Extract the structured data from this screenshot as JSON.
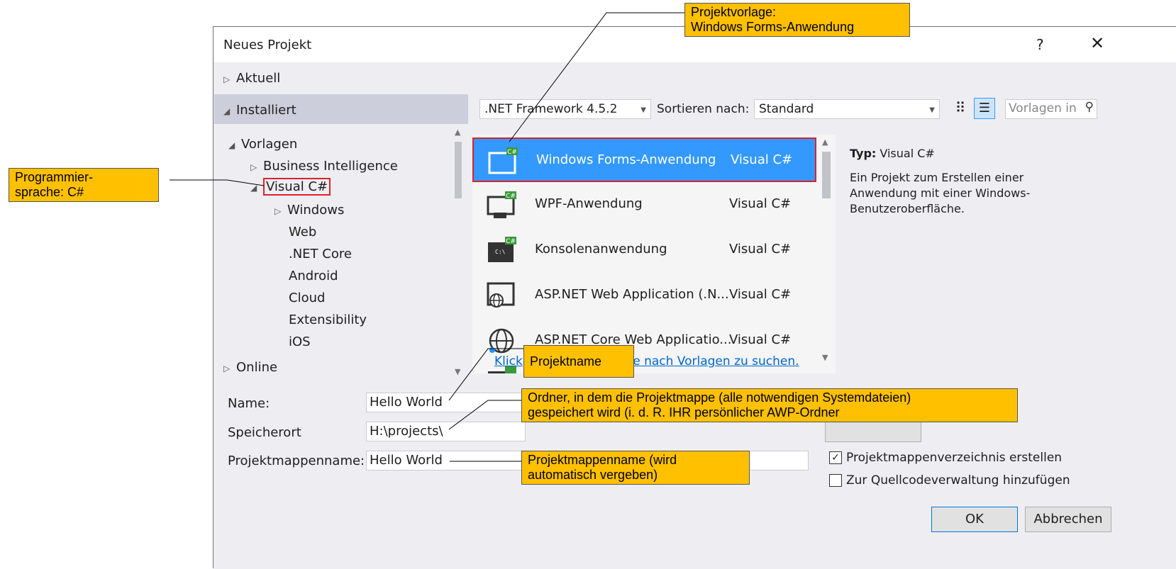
{
  "dialog": {
    "title": "Neues Projekt",
    "help": "?",
    "close": "✕"
  },
  "tree": {
    "aktuell": "Aktuell",
    "installiert": "Installiert",
    "vorlagen": "Vorlagen",
    "business_intelligence": "Business Intelligence",
    "visual_csharp": "Visual C#",
    "items": [
      "Windows",
      "Web",
      ".NET Core",
      "Android",
      "Cloud",
      "Extensibility",
      "iOS"
    ],
    "online": "Online"
  },
  "toolbar": {
    "framework": ".NET Framework 4.5.2",
    "sort_label": "Sortieren nach:",
    "sort_value": "Standard",
    "search_placeholder": "Vorlagen in"
  },
  "templates": [
    {
      "name": "Windows Forms-Anwendung",
      "lang": "Visual C#",
      "selected": true
    },
    {
      "name": "WPF-Anwendung",
      "lang": "Visual C#",
      "selected": false
    },
    {
      "name": "Konsolenanwendung",
      "lang": "Visual C#",
      "selected": false
    },
    {
      "name": "ASP.NET Web Application (.N...",
      "lang": "Visual C#",
      "selected": false
    },
    {
      "name": "ASP.NET Core Web Applicatio...",
      "lang": "Visual C#",
      "selected": false
    }
  ],
  "online_link": "Klicken Sie hier, um online nach Vorlagen zu suchen.",
  "online_link_visible_start": "Klick",
  "online_link_visible_end": "line nach Vorlagen zu suchen.",
  "details": {
    "type_label": "Typ:",
    "type_value": "Visual C#",
    "description": "Ein Projekt zum Erstellen einer Anwendung mit einer Windows-Benutzeroberfläche."
  },
  "form": {
    "name_label": "Name:",
    "name_value": "Hello World",
    "location_label": "Speicherort",
    "location_value": "H:\\projects\\",
    "solution_label": "Projektmappenname:",
    "solution_value": "Hello World",
    "create_dir_label": "Projektmappenverzeichnis erstellen",
    "create_dir_checked": true,
    "source_control_label": "Zur Quellcodeverwaltung hinzufügen",
    "source_control_checked": false,
    "ok": "OK",
    "cancel": "Abbrechen"
  },
  "annotations": {
    "vorlage": "Projektvorlage:\nWindows Forms-Anwendung",
    "sprache": "Programmier-\nsprache: C#",
    "projektname": "Projektname",
    "ordner": "Ordner, in dem die Projektmappe (alle notwendigen Systemdateien)\ngespeichert wird (i. d. R. IHR persönlicher AWP-Ordner",
    "mappenname": "Projektmappenname (wird\nautomatisch vergeben)"
  },
  "colors": {
    "selection": "#3399ff",
    "highlight_border": "#e0202a",
    "annotation": "#ffc000",
    "link": "#0066cc"
  }
}
